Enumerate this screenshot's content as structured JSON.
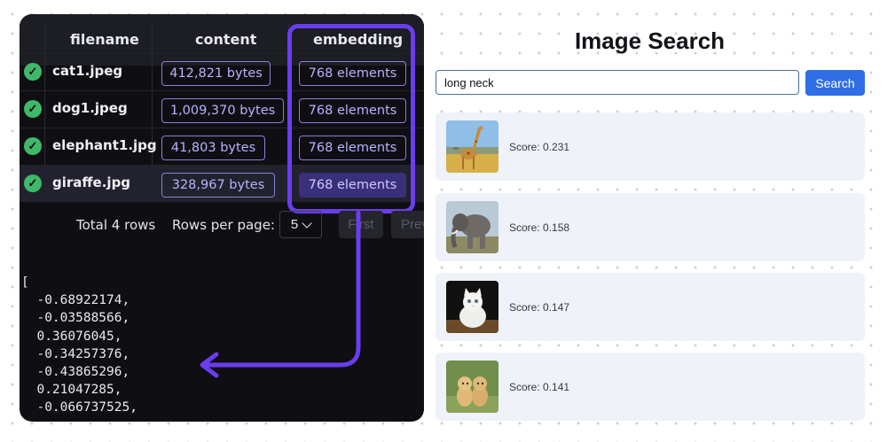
{
  "table": {
    "columns": {
      "filename": "filename",
      "content": "content",
      "embedding": "embedding"
    },
    "rows": [
      {
        "filename": "cat1.jpeg",
        "content": "412,821 bytes",
        "embedding": "768 elements"
      },
      {
        "filename": "dog1.jpeg",
        "content": "1,009,370 bytes",
        "embedding": "768 elements"
      },
      {
        "filename": "elephant1.jpg",
        "content": "41,803 bytes",
        "embedding": "768 elements"
      },
      {
        "filename": "giraffe.jpg",
        "content": "328,967 bytes",
        "embedding": "768 elements"
      }
    ],
    "check_icon": "check-circle-icon",
    "selected_row": 3
  },
  "footer": {
    "total": "Total 4 rows",
    "rows_per_page_label": "Rows per page:",
    "rows_per_page_value": "5",
    "first": "First",
    "prev": "Prev"
  },
  "vector": {
    "open": "[",
    "values": [
      "-0.68922174,",
      "-0.03588566,",
      "0.36076045,",
      "-0.34257376,",
      "-0.43865296,",
      "0.21047285,",
      "-0.066737525,"
    ]
  },
  "colors": {
    "highlight": "#6a3df0",
    "accent_button": "#2f6ee5",
    "check": "#3fb86a",
    "pill_text": "#b9b1ff"
  },
  "search": {
    "title": "Image Search",
    "query": "long neck",
    "button": "Search",
    "results": [
      {
        "image": "giraffe",
        "score": "Score: 0.231"
      },
      {
        "image": "elephant",
        "score": "Score: 0.158"
      },
      {
        "image": "cat",
        "score": "Score: 0.147"
      },
      {
        "image": "dogs",
        "score": "Score: 0.141"
      }
    ]
  }
}
